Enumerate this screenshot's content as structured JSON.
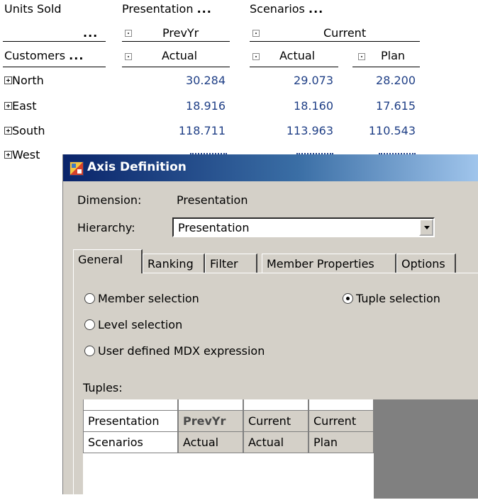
{
  "pivot": {
    "header_units": "Units Sold",
    "header_presentation": "Presentation",
    "header_scenarios": "Scenarios",
    "ellipsis": "...",
    "col_prevyr": "PrevYr",
    "col_current": "Current",
    "col_actual_1": "Actual",
    "col_actual_2": "Actual",
    "col_plan": "Plan",
    "header_customers": "Customers",
    "rows": [
      {
        "label": "North",
        "v1": "30.284",
        "v2": "29.073",
        "v3": "28.200"
      },
      {
        "label": "East",
        "v1": "18.916",
        "v2": "18.160",
        "v3": "17.615"
      },
      {
        "label": "South",
        "v1": "118.711",
        "v2": "113.963",
        "v3": "110.543"
      },
      {
        "label": "West"
      }
    ]
  },
  "dialog": {
    "title": "Axis Definition",
    "dimension_label": "Dimension:",
    "dimension_value": "Presentation",
    "hierarchy_label": "Hierarchy:",
    "hierarchy_value": "Presentation",
    "tabs": [
      "General",
      "Ranking",
      "Filter",
      "Member Properties",
      "Options"
    ],
    "radios": {
      "member": "Member selection",
      "tuple": "Tuple selection",
      "level": "Level selection",
      "mdx": "User defined MDX expression"
    },
    "tuples_label": "Tuples:",
    "tuples": {
      "rows": [
        {
          "header": "Presentation",
          "cells": [
            "PrevYr",
            "Current",
            "Current"
          ]
        },
        {
          "header": "Scenarios",
          "cells": [
            "Actual",
            "Actual",
            "Plan"
          ]
        }
      ]
    }
  },
  "colors": {
    "number_blue": "#1f3f86",
    "dialog_bg": "#d4d0c8",
    "title_dark": "#0a246a"
  }
}
